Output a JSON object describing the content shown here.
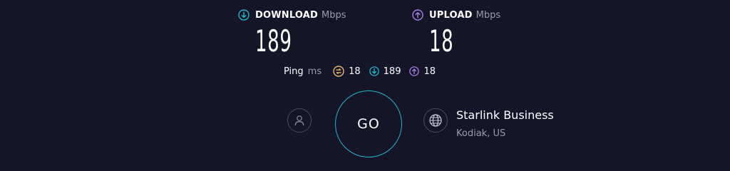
{
  "download": {
    "label": "DOWNLOAD",
    "unit": "Mbps",
    "value": "189",
    "icon": "download-arrow-icon",
    "color": "#1fb8cd"
  },
  "upload": {
    "label": "UPLOAD",
    "unit": "Mbps",
    "value": "18",
    "icon": "upload-arrow-icon",
    "color": "#a77ee8"
  },
  "ping": {
    "label": "Ping",
    "unit": "ms",
    "idle": {
      "value": "18",
      "icon": "ping-idle-icon",
      "color": "#e8b46c"
    },
    "download": {
      "value": "189",
      "icon": "download-arrow-icon",
      "color": "#1fb8cd"
    },
    "upload": {
      "value": "18",
      "icon": "upload-arrow-icon",
      "color": "#a77ee8"
    }
  },
  "go_button": {
    "label": "GO"
  },
  "server": {
    "name": "Starlink Business",
    "location": "Kodiak, US",
    "icon": "globe-icon"
  },
  "user_icon": "user-icon",
  "colors": {
    "background": "#141526",
    "accent_go": "#1fb8cd",
    "muted_text": "#9a9cae"
  }
}
